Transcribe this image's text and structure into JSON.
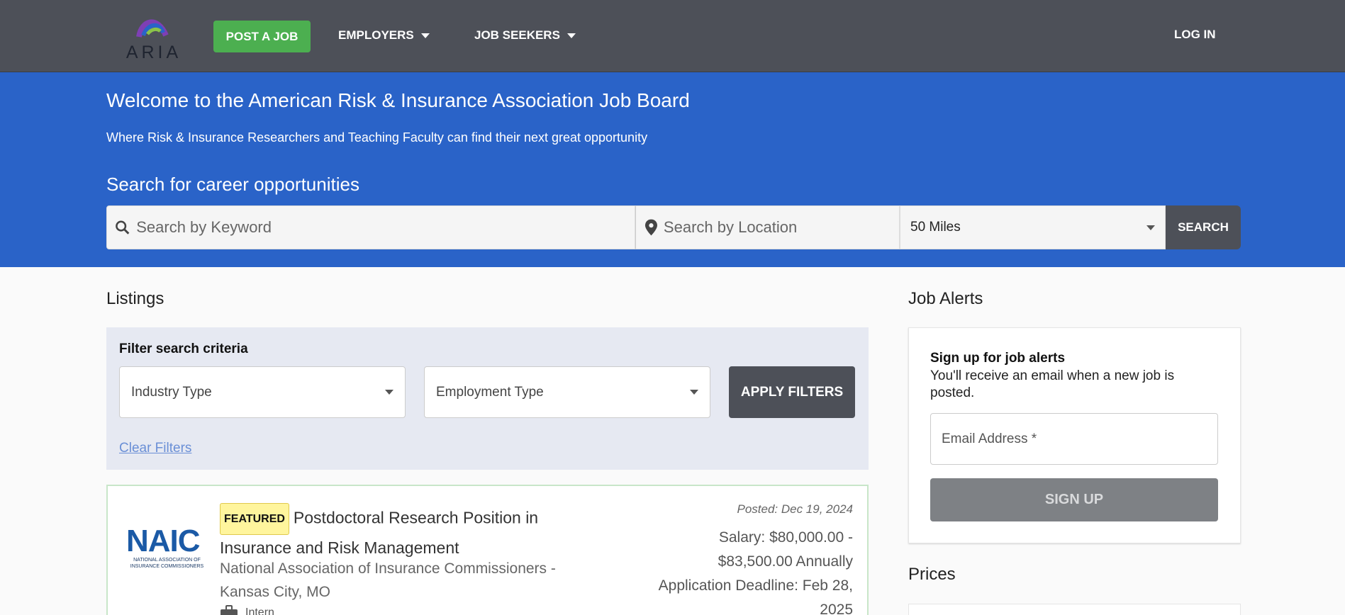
{
  "header": {
    "logo_text": "ARIA",
    "post_job_label": "POST A JOB",
    "nav": [
      {
        "label": "EMPLOYERS"
      },
      {
        "label": "JOB SEEKERS"
      }
    ],
    "login_label": "LOG IN"
  },
  "hero": {
    "title": "Welcome to the American Risk & Insurance Association Job Board",
    "subtitle": "Where Risk & Insurance Researchers and Teaching Faculty can find their next great opportunity",
    "search_title": "Search for career opportunities",
    "keyword_placeholder": "Search by Keyword",
    "location_placeholder": "Search by Location",
    "radius_selected": "50 Miles",
    "search_label": "SEARCH"
  },
  "listings": {
    "heading": "Listings",
    "filter_label": "Filter search criteria",
    "industry_select": "Industry Type",
    "employment_select": "Employment Type",
    "apply_label": "APPLY FILTERS",
    "clear_label": "Clear Filters",
    "jobs": [
      {
        "badge": "FEATURED",
        "title": "Postdoctoral Research Position in Insurance and Risk Management",
        "company": "National Association of Insurance Commissioners - Kansas City, MO",
        "type": "Intern",
        "posted": "Posted: Dec 19, 2024",
        "salary": "Salary: $80,000.00 - $83,500.00 Annually",
        "deadline": "Application Deadline: Feb 28, 2025",
        "logo_word": "NAIC",
        "logo_sub": "NATIONAL ASSOCIATION OF INSURANCE COMMISSIONERS"
      }
    ]
  },
  "sidebar": {
    "alerts_heading": "Job Alerts",
    "alerts_title": "Sign up for job alerts",
    "alerts_desc": "You'll receive an email when a new job is posted.",
    "email_placeholder": "Email Address *",
    "signup_label": "SIGN UP",
    "prices_heading": "Prices"
  },
  "colors": {
    "topbar": "#4d5058",
    "hero": "#2a63c8",
    "post_job": "#4caf50",
    "featured": "#fff59d"
  },
  "icons": [
    "aria-logo-icon",
    "chevron-down-icon",
    "search-icon",
    "location-pin-icon",
    "briefcase-icon"
  ]
}
